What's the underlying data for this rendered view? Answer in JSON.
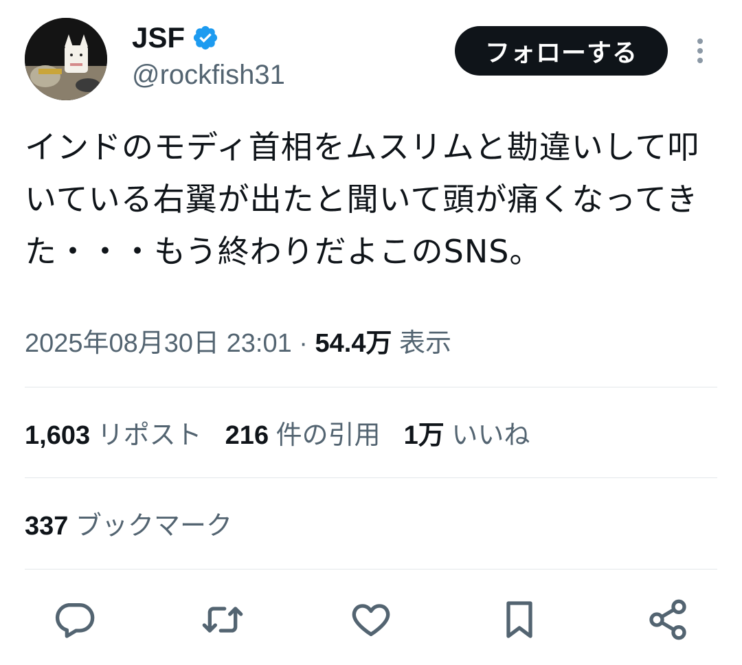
{
  "author": {
    "name": "JSF",
    "handle": "@rockfish31",
    "verified": true,
    "verified_color": "#1d9bf0"
  },
  "follow_button": {
    "label": "フォローする"
  },
  "more_icon": "more-vertical-icon",
  "tweet": {
    "text": "インドのモディ首相をムスリムと勘違いして叩いている右翼が出たと聞いて頭が痛くなってきた・・・もう終わりだよこのSNS。",
    "timestamp": "2025年08月30日 23:01",
    "separator": "·",
    "views_count": "54.4万",
    "views_label": "表示"
  },
  "stats": {
    "reposts_count": "1,603",
    "reposts_label": "リポスト",
    "quotes_count": "216",
    "quotes_label": "件の引用",
    "likes_count": "1万",
    "likes_label": "いいね",
    "bookmarks_count": "337",
    "bookmarks_label": "ブックマーク"
  },
  "actions": [
    {
      "icon": "reply-icon"
    },
    {
      "icon": "repost-icon"
    },
    {
      "icon": "like-heart-icon"
    },
    {
      "icon": "bookmark-icon"
    },
    {
      "icon": "share-icon"
    }
  ],
  "colors": {
    "text_primary": "#0f1419",
    "text_secondary": "#536471",
    "divider": "#e3e7ea",
    "button_bg": "#0f1419"
  }
}
